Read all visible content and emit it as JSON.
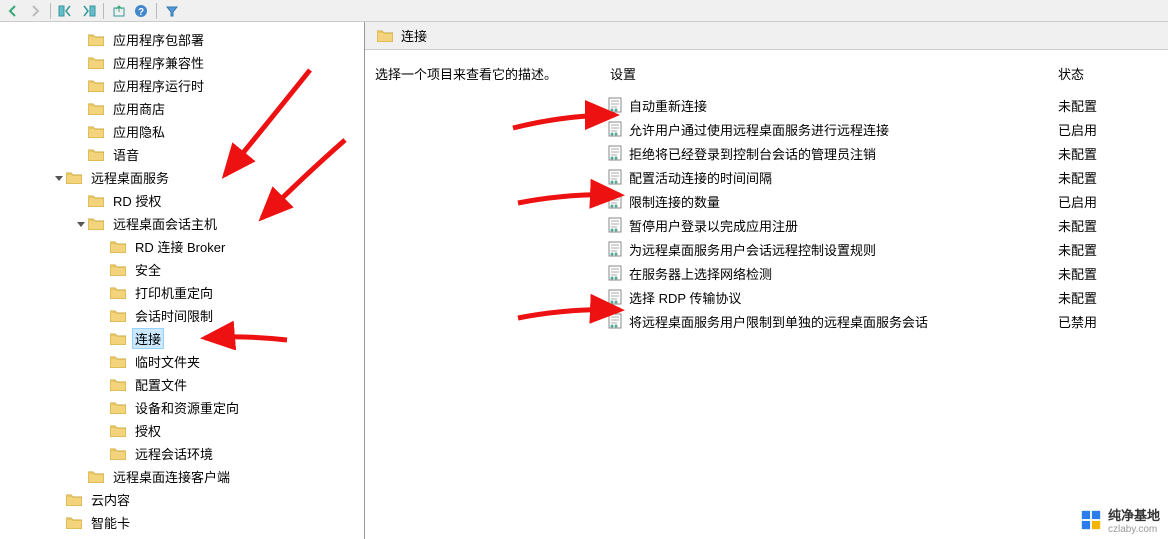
{
  "toolbar": {
    "items": [
      "back",
      "fwd",
      "sep",
      "prev",
      "next",
      "sep",
      "refresh",
      "help",
      "sep",
      "filter"
    ]
  },
  "tree": [
    {
      "level": 4,
      "exp": "",
      "label": "应用程序包部署"
    },
    {
      "level": 4,
      "exp": "",
      "label": "应用程序兼容性"
    },
    {
      "level": 4,
      "exp": "",
      "label": "应用程序运行时"
    },
    {
      "level": 4,
      "exp": "",
      "label": "应用商店"
    },
    {
      "level": 4,
      "exp": "",
      "label": "应用隐私"
    },
    {
      "level": 4,
      "exp": "",
      "label": "语音"
    },
    {
      "level": 3,
      "exp": "open",
      "label": "远程桌面服务"
    },
    {
      "level": 4,
      "exp": "",
      "label": "RD 授权"
    },
    {
      "level": 4,
      "exp": "open",
      "label": "远程桌面会话主机"
    },
    {
      "level": 5,
      "exp": "",
      "label": "RD 连接 Broker"
    },
    {
      "level": 5,
      "exp": "",
      "label": "安全"
    },
    {
      "level": 5,
      "exp": "",
      "label": "打印机重定向"
    },
    {
      "level": 5,
      "exp": "",
      "label": "会话时间限制"
    },
    {
      "level": 5,
      "exp": "",
      "label": "连接",
      "selected": true
    },
    {
      "level": 5,
      "exp": "",
      "label": "临时文件夹"
    },
    {
      "level": 5,
      "exp": "",
      "label": "配置文件"
    },
    {
      "level": 5,
      "exp": "",
      "label": "设备和资源重定向"
    },
    {
      "level": 5,
      "exp": "",
      "label": "授权"
    },
    {
      "level": 5,
      "exp": "",
      "label": "远程会话环境"
    },
    {
      "level": 4,
      "exp": "",
      "label": "远程桌面连接客户端"
    },
    {
      "level": 3,
      "exp": "",
      "label": "云内容"
    },
    {
      "level": 3,
      "exp": "",
      "label": "智能卡"
    }
  ],
  "content": {
    "title": "连接",
    "desc": "选择一个项目来查看它的描述。",
    "columns": {
      "setting": "设置",
      "status": "状态"
    },
    "rows": [
      {
        "name": "自动重新连接",
        "status": "未配置"
      },
      {
        "name": "允许用户通过使用远程桌面服务进行远程连接",
        "status": "已启用"
      },
      {
        "name": "拒绝将已经登录到控制台会话的管理员注销",
        "status": "未配置"
      },
      {
        "name": "配置活动连接的时间间隔",
        "status": "未配置"
      },
      {
        "name": "限制连接的数量",
        "status": "已启用"
      },
      {
        "name": "暂停用户登录以完成应用注册",
        "status": "未配置"
      },
      {
        "name": "为远程桌面服务用户会话远程控制设置规则",
        "status": "未配置"
      },
      {
        "name": "在服务器上选择网络检测",
        "status": "未配置"
      },
      {
        "name": "选择 RDP 传输协议",
        "status": "未配置"
      },
      {
        "name": "将远程桌面服务用户限制到单独的远程桌面服务会话",
        "status": "已禁用"
      }
    ]
  },
  "watermark": {
    "title": "纯净基地",
    "sub": "czlaby.com"
  }
}
